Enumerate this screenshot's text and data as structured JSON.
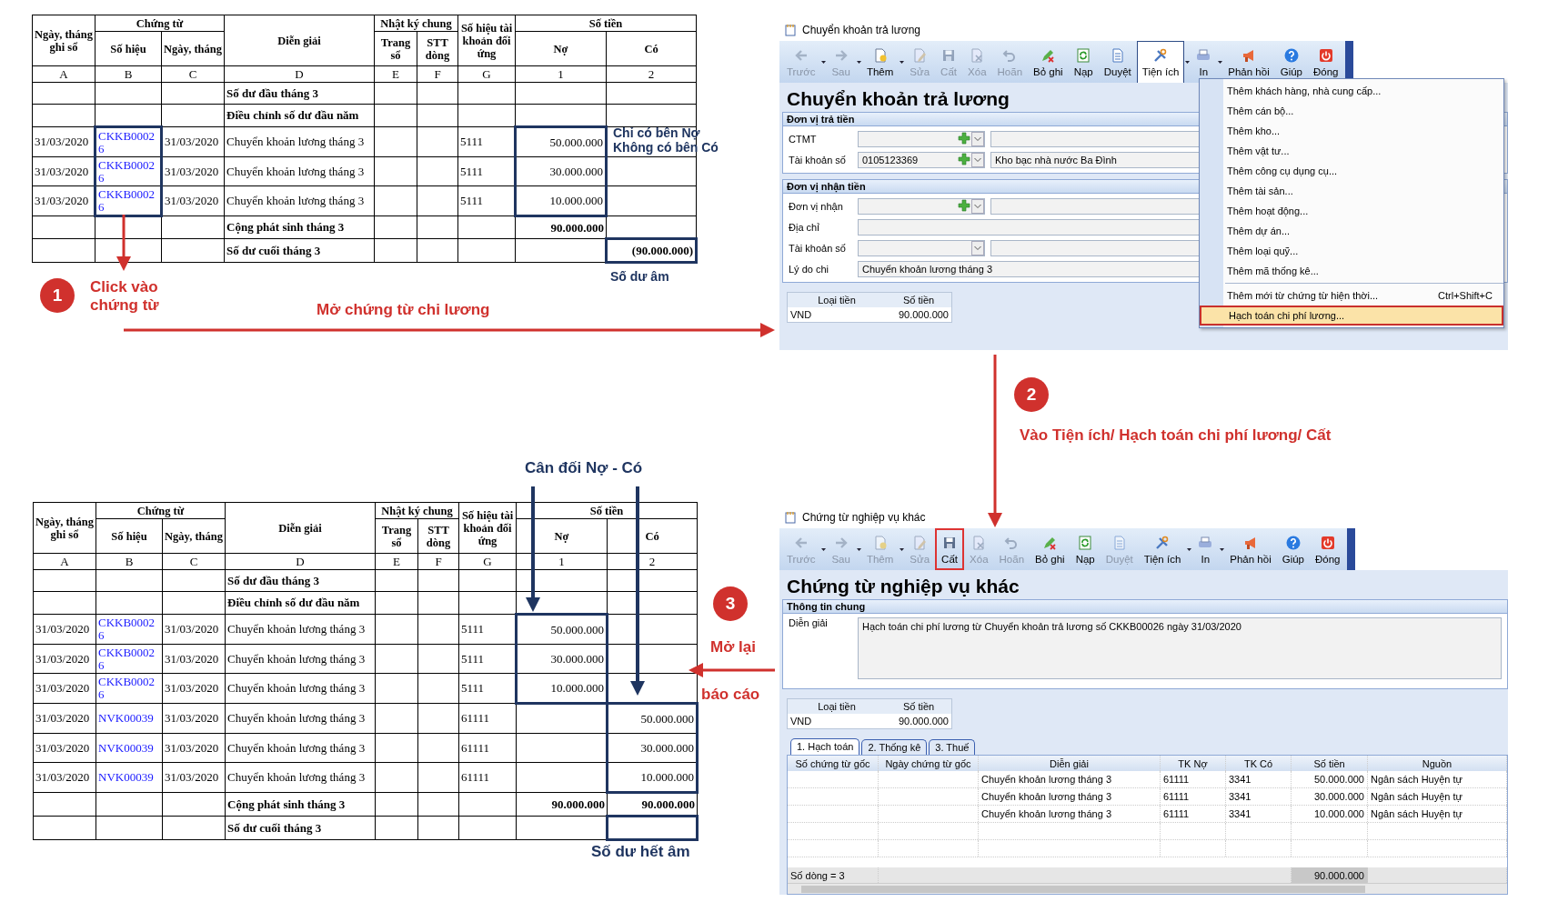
{
  "ledger_top": {
    "header": {
      "a": "Ngày, tháng ghi sổ",
      "chung_tu": "Chứng từ",
      "b": "Số hiệu",
      "c": "Ngày, tháng",
      "d": "Diễn giải",
      "nkc": "Nhật ký chung",
      "e": "Trang sổ",
      "f": "STT dòng",
      "g": "Số hiệu tài khoản đối ứng",
      "so_tien": "Số tiền",
      "no": "Nợ",
      "co": "Có"
    },
    "column_letters": [
      "A",
      "B",
      "C",
      "D",
      "E",
      "F",
      "G",
      "1",
      "2"
    ],
    "rows": [
      {
        "kind": "summary",
        "d": "Số dư đầu tháng 3"
      },
      {
        "kind": "summary",
        "d": "Điều chỉnh số dư đầu năm"
      },
      {
        "kind": "entry",
        "a": "31/03/2020",
        "b": "CKKB00026",
        "c": "31/03/2020",
        "d": "Chuyển khoản lương tháng 3",
        "g": "5111",
        "no": "50.000.000",
        "boxed": {
          "b": true,
          "no": true
        }
      },
      {
        "kind": "entry",
        "a": "31/03/2020",
        "b": "CKKB00026",
        "c": "31/03/2020",
        "d": "Chuyển khoản lương tháng 3",
        "g": "5111",
        "no": "30.000.000",
        "boxed": {
          "b": true,
          "no": true
        }
      },
      {
        "kind": "entry",
        "a": "31/03/2020",
        "b": "CKKB00026",
        "c": "31/03/2020",
        "d": "Chuyển khoản lương tháng 3",
        "g": "5111",
        "no": "10.000.000",
        "boxed": {
          "b": true,
          "no": true
        }
      },
      {
        "kind": "summary",
        "d": "Cộng phát sinh tháng 3",
        "no": "90.000.000"
      },
      {
        "kind": "summary",
        "d": "Số dư cuối tháng 3",
        "co": "(90.000.000)",
        "boxed": {
          "co": true
        }
      }
    ]
  },
  "window_top": {
    "title": "Chuyển khoản trả lương",
    "toolbar": [
      {
        "label": "Trước",
        "disabled": true,
        "dropdown": true,
        "pressed": false,
        "highlighted": false
      },
      {
        "label": "Sau",
        "disabled": true,
        "dropdown": true,
        "pressed": false,
        "highlighted": false
      },
      {
        "label": "Thêm",
        "disabled": false,
        "dropdown": true,
        "pressed": false,
        "highlighted": false
      },
      {
        "label": "Sửa",
        "disabled": true,
        "dropdown": false,
        "pressed": false,
        "highlighted": false
      },
      {
        "label": "Cất",
        "disabled": true,
        "dropdown": false,
        "pressed": false,
        "highlighted": false
      },
      {
        "label": "Xóa",
        "disabled": true,
        "dropdown": false,
        "pressed": false,
        "highlighted": false
      },
      {
        "label": "Hoãn",
        "disabled": true,
        "dropdown": false,
        "pressed": false,
        "highlighted": false
      },
      {
        "label": "Bỏ ghi",
        "disabled": false,
        "dropdown": false,
        "pressed": false,
        "highlighted": false
      },
      {
        "label": "Nạp",
        "disabled": false,
        "dropdown": false,
        "pressed": false,
        "highlighted": false
      },
      {
        "label": "Duyệt",
        "disabled": false,
        "dropdown": false,
        "pressed": false,
        "highlighted": false
      },
      {
        "label": "Tiện ích",
        "disabled": false,
        "dropdown": true,
        "pressed": true,
        "highlighted": false
      },
      {
        "label": "In",
        "disabled": false,
        "dropdown": true,
        "pressed": false,
        "highlighted": false
      },
      {
        "label": "Phản hồi",
        "disabled": false,
        "dropdown": false,
        "pressed": false,
        "highlighted": false
      },
      {
        "label": "Giúp",
        "disabled": false,
        "dropdown": false,
        "pressed": false,
        "highlighted": false
      },
      {
        "label": "Đóng",
        "disabled": false,
        "dropdown": false,
        "pressed": false,
        "highlighted": false
      }
    ],
    "heading": "Chuyển khoản trả lương",
    "sections": [
      {
        "title": "Đơn vị trả tiền",
        "fields": [
          {
            "kind": "lookup",
            "label": "CTMT"
          },
          {
            "kind": "lookup",
            "label": "Tài khoản số",
            "value": "0105123369",
            "detail": "Kho bạc nhà nước Ba Đình"
          }
        ]
      },
      {
        "title": "Đơn vị nhận tiền",
        "fields": [
          {
            "kind": "lookup",
            "label": "Đơn vị nhận"
          },
          {
            "kind": "text",
            "label": "Địa chỉ"
          },
          {
            "kind": "combo",
            "label": "Tài khoản số"
          },
          {
            "kind": "text",
            "label": "Lý do chi",
            "value": "Chuyển khoản lương tháng 3"
          }
        ]
      }
    ],
    "currency": {
      "columns": [
        "Loại tiền",
        "Số tiền"
      ],
      "rows": [
        [
          "VND",
          "90.000.000"
        ]
      ]
    },
    "menu": {
      "items": [
        {
          "label": "Thêm khách hàng, nhà cung cấp...",
          "selected": false,
          "separated": false
        },
        {
          "label": "Thêm cán bộ...",
          "selected": false,
          "separated": false
        },
        {
          "label": "Thêm kho...",
          "selected": false,
          "separated": false
        },
        {
          "label": "Thêm vật tư...",
          "selected": false,
          "separated": false
        },
        {
          "label": "Thêm công cụ dụng cụ...",
          "selected": false,
          "separated": false
        },
        {
          "label": "Thêm tài sản...",
          "selected": false,
          "separated": false
        },
        {
          "label": "Thêm hoạt động...",
          "selected": false,
          "separated": false
        },
        {
          "label": "Thêm dự án...",
          "selected": false,
          "separated": false
        },
        {
          "label": "Thêm loại quỹ...",
          "selected": false,
          "separated": false
        },
        {
          "label": "Thêm mã thống kê...",
          "selected": false,
          "separated": false
        },
        {
          "label": "Thêm mới từ chứng từ hiện thời...",
          "shortcut": "Ctrl+Shift+C",
          "selected": false,
          "separated": true
        },
        {
          "label": "Hạch toán chi phí lương...",
          "selected": true,
          "separated": false
        }
      ]
    }
  },
  "ledger_bottom": {
    "header": {
      "a": "Ngày, tháng ghi sổ",
      "chung_tu": "Chứng từ",
      "b": "Số hiệu",
      "c": "Ngày, tháng",
      "d": "Diễn giải",
      "nkc": "Nhật ký chung",
      "e": "Trang sổ",
      "f": "STT dòng",
      "g": "Số hiệu tài khoản đối ứng",
      "so_tien": "Số tiền",
      "no": "Nợ",
      "co": "Có"
    },
    "column_letters": [
      "A",
      "B",
      "C",
      "D",
      "E",
      "F",
      "G",
      "1",
      "2"
    ],
    "rows": [
      {
        "kind": "summary",
        "d": "Số dư đầu tháng 3"
      },
      {
        "kind": "summary",
        "d": "Điều chỉnh số dư đầu năm"
      },
      {
        "kind": "entry",
        "a": "31/03/2020",
        "b": "CKKB00026",
        "c": "31/03/2020",
        "d": "Chuyển khoản lương tháng 3",
        "g": "5111",
        "no": "50.000.000",
        "boxed": {
          "no": true
        }
      },
      {
        "kind": "entry",
        "a": "31/03/2020",
        "b": "CKKB00026",
        "c": "31/03/2020",
        "d": "Chuyển khoản lương tháng 3",
        "g": "5111",
        "no": "30.000.000",
        "boxed": {
          "no": true
        }
      },
      {
        "kind": "entry",
        "a": "31/03/2020",
        "b": "CKKB00026",
        "c": "31/03/2020",
        "d": "Chuyển khoản lương tháng 3",
        "g": "5111",
        "no": "10.000.000",
        "boxed": {
          "no": true
        }
      },
      {
        "kind": "entry",
        "a": "31/03/2020",
        "b": "NVK00039",
        "c": "31/03/2020",
        "d": "Chuyển khoản lương tháng 3",
        "g": "61111",
        "co": "50.000.000",
        "boxed": {
          "co": true
        }
      },
      {
        "kind": "entry",
        "a": "31/03/2020",
        "b": "NVK00039",
        "c": "31/03/2020",
        "d": "Chuyển khoản lương tháng 3",
        "g": "61111",
        "co": "30.000.000",
        "boxed": {
          "co": true
        }
      },
      {
        "kind": "entry",
        "a": "31/03/2020",
        "b": "NVK00039",
        "c": "31/03/2020",
        "d": "Chuyển khoản lương tháng 3",
        "g": "61111",
        "co": "10.000.000",
        "boxed": {
          "co": true
        }
      },
      {
        "kind": "summary",
        "d": "Cộng phát sinh tháng 3",
        "no": "90.000.000",
        "co": "90.000.000"
      },
      {
        "kind": "summary",
        "d": "Số dư cuối tháng 3",
        "boxed": {
          "co": true
        }
      }
    ]
  },
  "window_bottom": {
    "title": "Chứng từ nghiệp vụ khác",
    "toolbar": [
      {
        "label": "Trước",
        "disabled": true,
        "dropdown": true,
        "pressed": false,
        "highlighted": false
      },
      {
        "label": "Sau",
        "disabled": true,
        "dropdown": true,
        "pressed": false,
        "highlighted": false
      },
      {
        "label": "Thêm",
        "disabled": true,
        "dropdown": true,
        "pressed": false,
        "highlighted": false
      },
      {
        "label": "Sửa",
        "disabled": true,
        "dropdown": false,
        "pressed": false,
        "highlighted": false
      },
      {
        "label": "Cất",
        "disabled": false,
        "dropdown": false,
        "pressed": false,
        "highlighted": true
      },
      {
        "label": "Xóa",
        "disabled": true,
        "dropdown": false,
        "pressed": false,
        "highlighted": false
      },
      {
        "label": "Hoãn",
        "disabled": true,
        "dropdown": false,
        "pressed": false,
        "highlighted": false
      },
      {
        "label": "Bỏ ghi",
        "disabled": false,
        "dropdown": false,
        "pressed": false,
        "highlighted": false
      },
      {
        "label": "Nạp",
        "disabled": false,
        "dropdown": false,
        "pressed": false,
        "highlighted": false
      },
      {
        "label": "Duyệt",
        "disabled": true,
        "dropdown": false,
        "pressed": false,
        "highlighted": false
      },
      {
        "label": "Tiện ích",
        "disabled": false,
        "dropdown": true,
        "pressed": false,
        "highlighted": false
      },
      {
        "label": "In",
        "disabled": false,
        "dropdown": true,
        "pressed": false,
        "highlighted": false
      },
      {
        "label": "Phản hồi",
        "disabled": false,
        "dropdown": false,
        "pressed": false,
        "highlighted": false
      },
      {
        "label": "Giúp",
        "disabled": false,
        "dropdown": false,
        "pressed": false,
        "highlighted": false
      },
      {
        "label": "Đóng",
        "disabled": false,
        "dropdown": false,
        "pressed": false,
        "highlighted": false
      }
    ],
    "heading": "Chứng từ nghiệp vụ khác",
    "sections": [
      {
        "title": "Thông tin chung",
        "fields": [
          {
            "kind": "memo",
            "label": "Diễn giải",
            "value": "Hạch toán chi phí lương từ Chuyển khoản trả lương số CKKB00026 ngày 31/03/2020"
          }
        ]
      }
    ],
    "currency": {
      "columns": [
        "Loại tiền",
        "Số tiền"
      ],
      "rows": [
        [
          "VND",
          "90.000.000"
        ]
      ]
    },
    "tabs": [
      {
        "label": "1. Hạch toán",
        "selected": true
      },
      {
        "label": "2. Thống kê",
        "selected": false
      },
      {
        "label": "3. Thuế",
        "selected": false
      }
    ],
    "grid": {
      "columns": [
        "Số chứng từ gốc",
        "Ngày chứng từ gốc",
        "Diễn giải",
        "TK Nợ",
        "TK Có",
        "Số tiền",
        "Nguồn"
      ],
      "rows": [
        [
          "",
          "",
          "Chuyển khoản lương tháng 3",
          "61111",
          "3341",
          "50.000.000",
          "Ngân sách Huyện tự"
        ],
        [
          "",
          "",
          "Chuyển khoản lương tháng 3",
          "61111",
          "3341",
          "30.000.000",
          "Ngân sách Huyện tự"
        ],
        [
          "",
          "",
          "Chuyển khoản lương tháng 3",
          "61111",
          "3341",
          "10.000.000",
          "Ngân sách Huyện tự"
        ]
      ],
      "footer": {
        "count": "Số dòng = 3",
        "total": "90.000.000"
      }
    }
  },
  "annotations": {
    "step_badges": [
      "1",
      "2",
      "3"
    ],
    "notes": [
      {
        "lines": [
          "Click vào",
          "chứng từ"
        ],
        "color": "#d0312d"
      },
      {
        "lines": [
          "Mở chứng từ chi lương"
        ],
        "color": "#d0312d"
      },
      {
        "lines": [
          "Chỉ có bên Nợ",
          "Không có bên Có"
        ],
        "color": "#1f3560"
      },
      {
        "lines": [
          "Số dư âm"
        ],
        "color": "#1f3560"
      },
      {
        "lines": [
          "Vào Tiện ích/ Hạch toán chi phí lương/ Cất"
        ],
        "color": "#d0312d"
      },
      {
        "lines": [
          "Cân đối Nợ - Có"
        ],
        "color": "#1f3560"
      },
      {
        "lines": [
          "Mở lại"
        ],
        "color": "#d0312d"
      },
      {
        "lines": [
          "báo cáo"
        ],
        "color": "#d0312d"
      },
      {
        "lines": [
          "Số dư hết âm"
        ],
        "color": "#1f3560"
      }
    ]
  }
}
